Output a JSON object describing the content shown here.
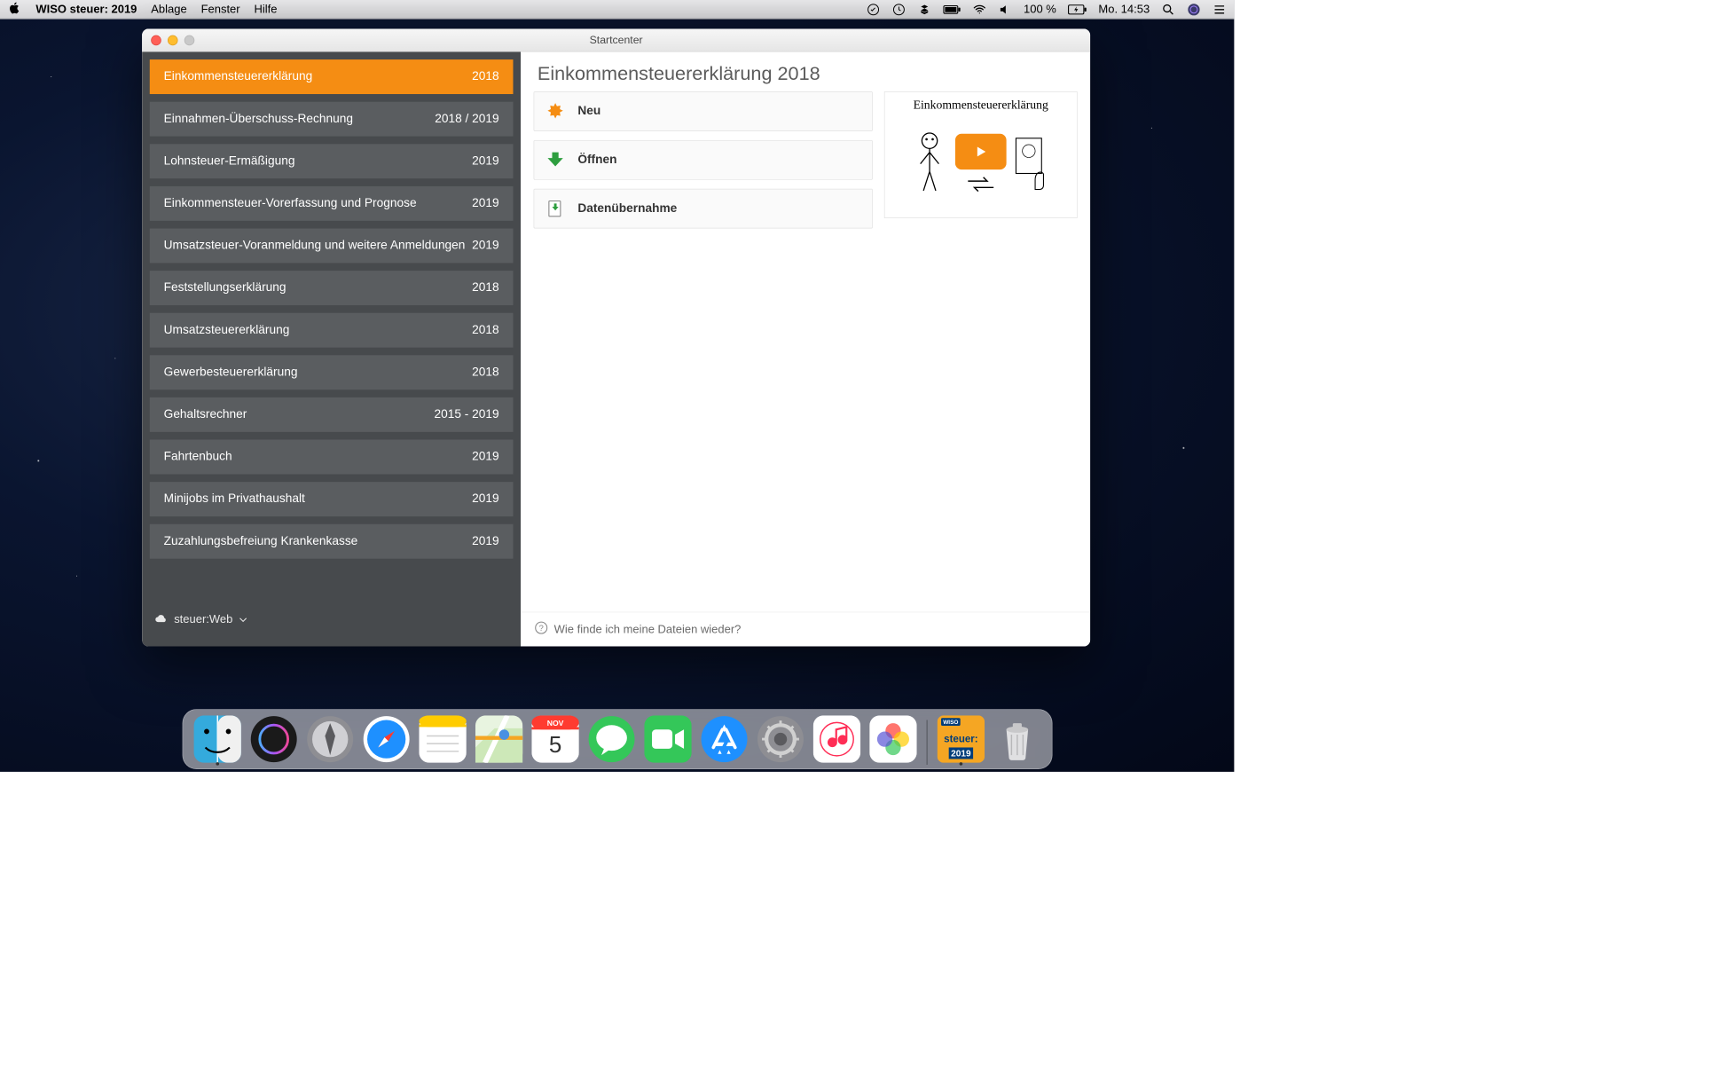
{
  "menubar": {
    "app": "WISO steuer: 2019",
    "items": [
      "Ablage",
      "Fenster",
      "Hilfe"
    ],
    "battery": "100 %",
    "clock": "Mo. 14:53"
  },
  "window": {
    "title": "Startcenter"
  },
  "sidebar": {
    "items": [
      {
        "label": "Einkommensteuererklärung",
        "year": "2018",
        "active": true
      },
      {
        "label": "Einnahmen-Überschuss-Rechnung",
        "year": "2018 / 2019"
      },
      {
        "label": "Lohnsteuer-Ermäßigung",
        "year": "2019"
      },
      {
        "label": "Einkommensteuer-Vorerfassung und Prognose",
        "year": "2019"
      },
      {
        "label": "Umsatzsteuer-Voranmeldung und weitere Anmeldungen",
        "year": "2019"
      },
      {
        "label": "Feststellungserklärung",
        "year": "2018"
      },
      {
        "label": "Umsatzsteuererklärung",
        "year": "2018"
      },
      {
        "label": "Gewerbesteuererklärung",
        "year": "2018"
      },
      {
        "label": "Gehaltsrechner",
        "year": "2015 - 2019"
      },
      {
        "label": "Fahrtenbuch",
        "year": "2019"
      },
      {
        "label": "Minijobs im Privathaushalt",
        "year": "2019"
      },
      {
        "label": "Zuzahlungsbefreiung Krankenkasse",
        "year": "2019"
      }
    ],
    "footer": "steuer:Web"
  },
  "main": {
    "title": "Einkommensteuererklärung 2018",
    "actions": [
      {
        "label": "Neu",
        "icon": "star-burst"
      },
      {
        "label": "Öffnen",
        "icon": "arrow-down"
      },
      {
        "label": "Datenübernahme",
        "icon": "document-import"
      }
    ],
    "promo_title": "Einkommensteuererklärung",
    "footer": "Wie finde ich meine Dateien wieder?"
  },
  "dock": {
    "items": [
      "finder",
      "siri",
      "launchpad",
      "safari",
      "notes",
      "maps",
      "calendar",
      "messages",
      "facetime",
      "appstore",
      "settings",
      "music",
      "photos",
      "wiso"
    ],
    "calendar_month": "NOV",
    "calendar_day": "5",
    "wiso_label_top": "steuer:",
    "wiso_label_bottom": "2019"
  }
}
